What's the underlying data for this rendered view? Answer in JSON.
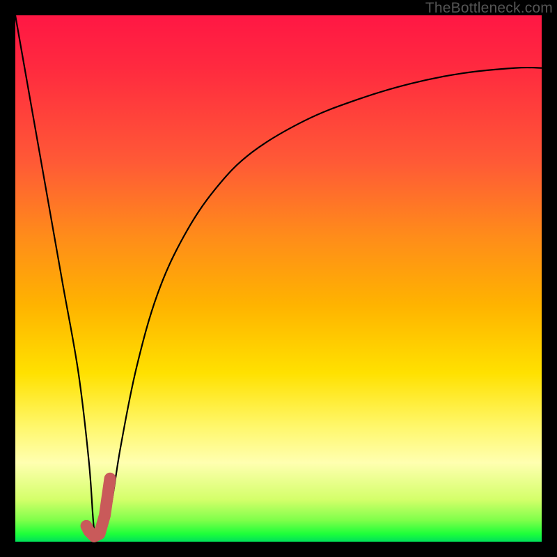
{
  "watermark": "TheBottleneck.com",
  "colors": {
    "gradient_top": "#ff1744",
    "gradient_mid1": "#ff8c1a",
    "gradient_mid2": "#ffe100",
    "gradient_bottom": "#00e05a",
    "curve": "#000000",
    "marker": "#c95a5a",
    "frame": "#000000"
  },
  "chart_data": {
    "type": "line",
    "title": "",
    "xlabel": "",
    "ylabel": "",
    "xlim": [
      0,
      100
    ],
    "ylim": [
      0,
      100
    ],
    "grid": false,
    "legend": false,
    "series": [
      {
        "name": "bottleneck-curve",
        "x": [
          0,
          3,
          6,
          9,
          12,
          14,
          15,
          16,
          18,
          20,
          23,
          27,
          32,
          38,
          45,
          55,
          65,
          75,
          85,
          95,
          100
        ],
        "y": [
          100,
          83,
          66,
          49,
          32,
          15,
          2,
          1,
          6,
          18,
          33,
          47,
          58,
          67,
          74,
          80,
          84,
          87,
          89,
          90,
          90
        ]
      },
      {
        "name": "optimal-marker",
        "x": [
          13.5,
          14.0,
          14.5,
          15.0,
          16.0,
          17.0,
          18.0
        ],
        "y": [
          3.0,
          2.0,
          1.5,
          1.0,
          1.5,
          5.0,
          12.0
        ]
      }
    ],
    "annotations": []
  }
}
